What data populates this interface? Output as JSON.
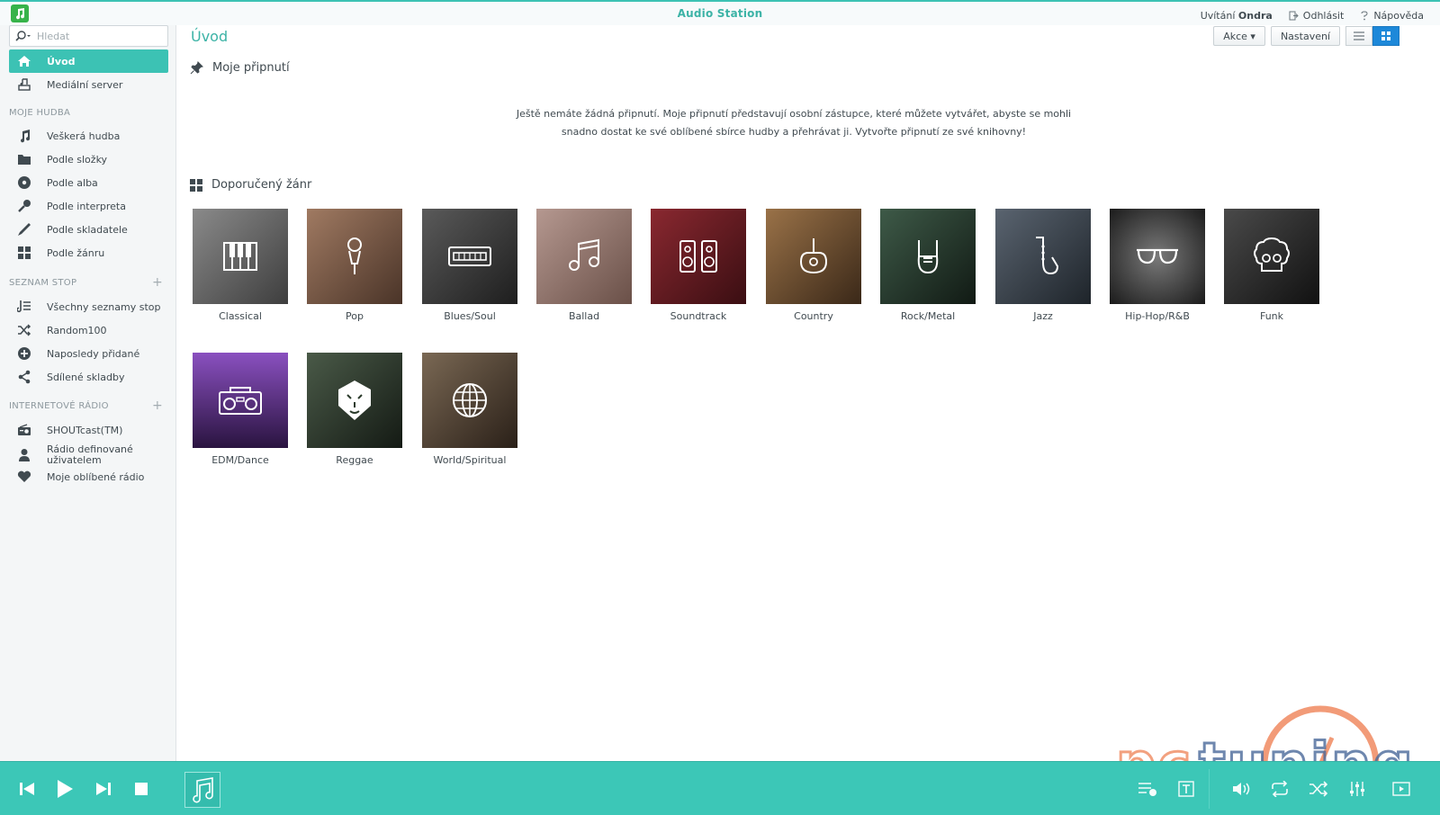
{
  "app": {
    "title": "Audio Station"
  },
  "top": {
    "welcome": "Uvítání",
    "user": "Ondra",
    "logout": "Odhlásit",
    "help": "Nápověda"
  },
  "search": {
    "placeholder": "Hledat"
  },
  "sidebar": {
    "top_items": [
      {
        "label": "Úvod",
        "icon": "home-icon"
      },
      {
        "label": "Mediální server",
        "icon": "media-server-icon"
      }
    ],
    "my_music": {
      "title": "MOJE HUDBA",
      "items": [
        {
          "label": "Veškerá hudba",
          "icon": "music-note-icon"
        },
        {
          "label": "Podle složky",
          "icon": "folder-icon"
        },
        {
          "label": "Podle alba",
          "icon": "disc-icon"
        },
        {
          "label": "Podle interpreta",
          "icon": "microphone-icon"
        },
        {
          "label": "Podle skladatele",
          "icon": "pen-icon"
        },
        {
          "label": "Podle žánru",
          "icon": "grid-icon"
        }
      ]
    },
    "playlists": {
      "title": "SEZNAM STOP",
      "plus": "+",
      "items": [
        {
          "label": "Všechny seznamy stop",
          "icon": "playlist-icon"
        },
        {
          "label": "Random100",
          "icon": "shuffle-icon"
        },
        {
          "label": "Naposledy přidané",
          "icon": "add-circle-icon"
        },
        {
          "label": "Sdílené skladby",
          "icon": "share-icon"
        }
      ]
    },
    "radio": {
      "title": "INTERNETOVÉ RÁDIO",
      "plus": "+",
      "items": [
        {
          "label": "SHOUTcast(TM)",
          "icon": "radio-icon"
        },
        {
          "label": "Rádio definované uživatelem",
          "icon": "user-icon"
        },
        {
          "label": "Moje oblíbené rádio",
          "icon": "heart-icon"
        }
      ]
    }
  },
  "main": {
    "title": "Úvod",
    "toolbar": {
      "actions": "Akce ▾",
      "settings": "Nastavení"
    },
    "pins": {
      "title": "Moje připnutí",
      "empty_line1": "Ještě nemáte žádná připnutí. Moje připnutí představují osobní zástupce, které můžete vytvářet, abyste se mohli",
      "empty_line2": "snadno dostat ke své oblíbené sbírce hudby a přehrávat ji. Vytvořte připnutí ze své knihovny!"
    },
    "genres": {
      "title": "Doporučený žánr",
      "items": [
        {
          "label": "Classical",
          "icon": "piano-icon",
          "bg": "#6a6a6a"
        },
        {
          "label": "Pop",
          "icon": "mic-icon",
          "bg": "#7a5a4a"
        },
        {
          "label": "Blues/Soul",
          "icon": "harmonica-icon",
          "bg": "#3a3a3a"
        },
        {
          "label": "Ballad",
          "icon": "note-icon",
          "bg": "#8a6f68"
        },
        {
          "label": "Soundtrack",
          "icon": "speakers-icon",
          "bg": "#6e2228"
        },
        {
          "label": "Country",
          "icon": "guitar-icon",
          "bg": "#7a5a3a"
        },
        {
          "label": "Rock/Metal",
          "icon": "rock-hand-icon",
          "bg": "#2a3a30"
        },
        {
          "label": "Jazz",
          "icon": "saxophone-icon",
          "bg": "#3e4650"
        },
        {
          "label": "Hip-Hop/R&B",
          "icon": "sunglasses-icon",
          "bg": "#3a3a3a"
        },
        {
          "label": "Funk",
          "icon": "afro-icon",
          "bg": "#2e2e2e"
        },
        {
          "label": "EDM/Dance",
          "icon": "boombox-icon",
          "bg": "#4a2a6a"
        },
        {
          "label": "Reggae",
          "icon": "lion-icon",
          "bg": "#2e3a2e"
        },
        {
          "label": "World/Spiritual",
          "icon": "globe-icon",
          "bg": "#5a4a3e"
        }
      ]
    }
  },
  "watermark": {
    "text": "pctuning"
  }
}
